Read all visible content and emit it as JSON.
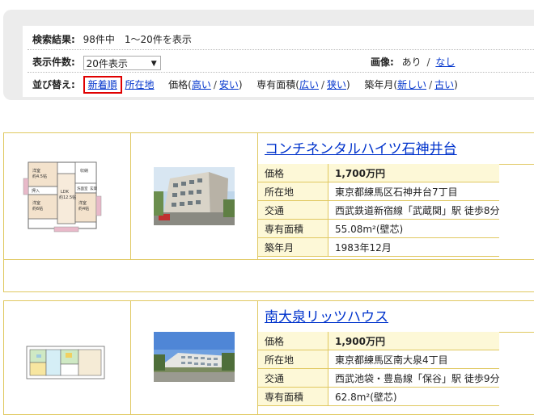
{
  "search": {
    "results_label": "検索結果:",
    "results_value": "98件中　1～20件を表示",
    "count_label": "表示件数:",
    "count_selected": "20件表示",
    "image_label": "画像:",
    "image_yes": "あり",
    "image_no": "なし",
    "sort_label": "並び替え:",
    "sort_newest": "新着順",
    "sort_location": "所在地",
    "sort_price_label": "価格(",
    "sort_price_high": "高い",
    "sort_price_low": "安い",
    "close_paren": ")",
    "sort_area_label": "専有面積(",
    "sort_area_wide": "広い",
    "sort_area_narrow": "狭い",
    "sort_age_label": "築年月(",
    "sort_age_new": "新しい",
    "sort_age_old": "古い",
    "slash": "/"
  },
  "spec_labels": {
    "price": "価格",
    "location": "所在地",
    "access": "交通",
    "area": "専有面積",
    "built": "築年月"
  },
  "listings": [
    {
      "name": "コンチネンタルハイツ石神井台",
      "price": "1,700万円",
      "location": "東京都練馬区石神井台7丁目",
      "access": "西武鉄道新宿線「武蔵関」駅 徒歩8分",
      "area": "55.08m²(壁芯)",
      "built": "1983年12月"
    },
    {
      "name": "南大泉リッツハウス",
      "price": "1,900万円",
      "location": "東京都練馬区南大泉4丁目",
      "access": "西武池袋・豊島線「保谷」駅 徒歩9分",
      "area": "62.8m²(壁芯)"
    }
  ],
  "floorplan_labels": [
    "洋室",
    "約4.5帖",
    "洋室",
    "約6帖",
    "LDK",
    "約12.5帖",
    "洋室",
    "約4帖",
    "押入",
    "収納",
    "洗面室",
    "玄関"
  ]
}
